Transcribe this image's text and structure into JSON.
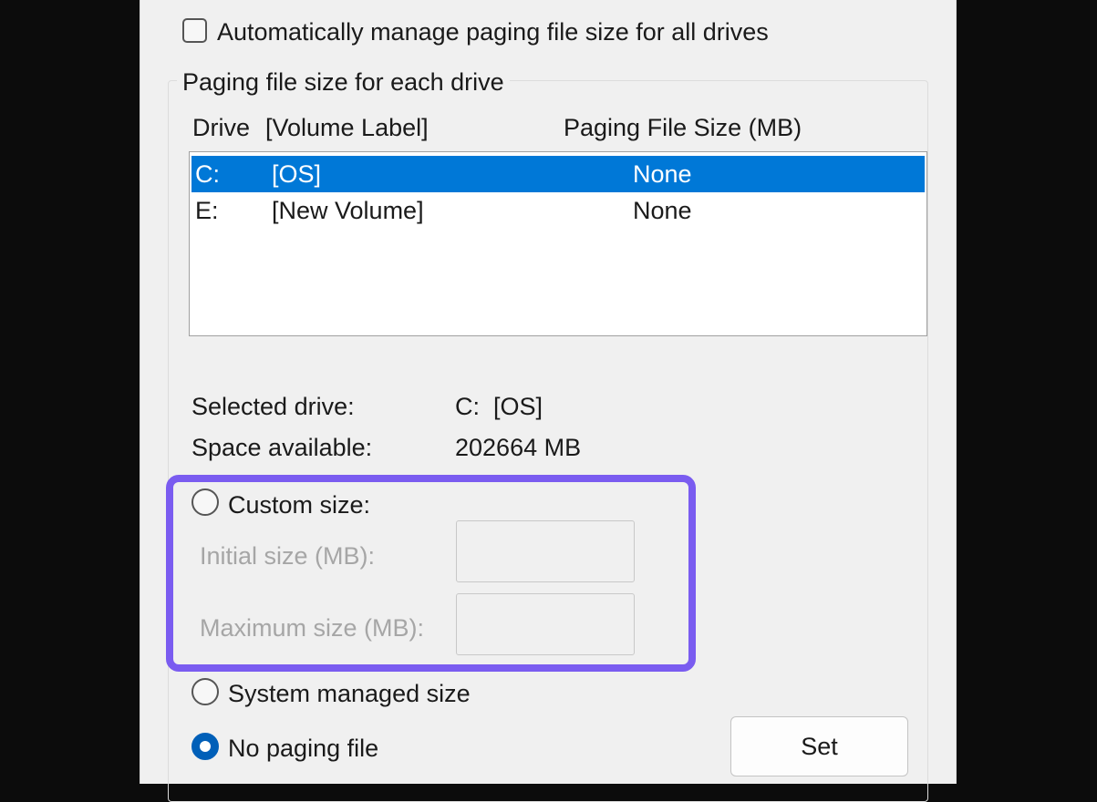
{
  "auto_manage": {
    "label": "Automatically manage paging file size for all drives",
    "checked": false
  },
  "group": {
    "title": "Paging file size for each drive",
    "headers": {
      "drive": "Drive",
      "label": "[Volume Label]",
      "size": "Paging File Size (MB)"
    },
    "drives": [
      {
        "drive": "C:",
        "label": "[OS]",
        "size": "None",
        "selected": true
      },
      {
        "drive": "E:",
        "label": "[New Volume]",
        "size": "None",
        "selected": false
      }
    ]
  },
  "info": {
    "selected_label": "Selected drive:",
    "selected_value": "C:  [OS]",
    "space_label": "Space available:",
    "space_value": "202664 MB"
  },
  "custom": {
    "label": "Custom size:",
    "initial_label": "Initial size (MB):",
    "initial_value": "",
    "maximum_label": "Maximum size (MB):",
    "maximum_value": ""
  },
  "system_managed": {
    "label": "System managed size"
  },
  "no_paging": {
    "label": "No paging file",
    "checked": true
  },
  "set_button": {
    "label": "Set"
  },
  "colors": {
    "selection": "#0078d7",
    "highlight": "#7a5cf0",
    "radio_checked": "#005fb8"
  }
}
